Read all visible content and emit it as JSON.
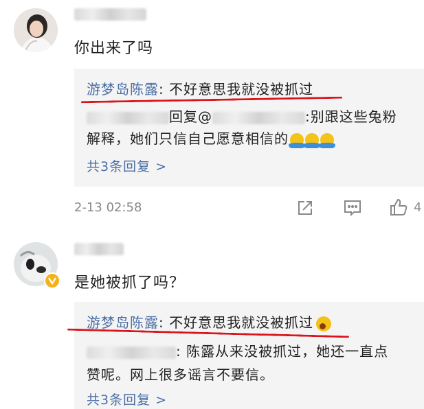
{
  "comments": [
    {
      "text": "你出来了吗",
      "reply_preview": {
        "author": "游梦岛陈露",
        "author_sep": ":",
        "author_text": " 不好意思我就没被抓过",
        "second_reply_mid": "回复@",
        "second_reply_tail": ":别跟这些兔粉",
        "second_reply_line2": "解释，她们只信自己愿意相信的",
        "more": "共3条回复 >"
      },
      "timestamp": "2-13 02:58",
      "like_count": "4"
    },
    {
      "text": "是她被抓了吗？",
      "reply_preview": {
        "author": "游梦岛陈露",
        "author_sep": ":",
        "author_text": " 不好意思我就没被抓过",
        "second_reply_tail": ": 陈露从来没被抓过，她还一直点",
        "second_reply_line2": "赞呢。网上很多谣言不要信。",
        "more": "共3条回复 >"
      }
    }
  ],
  "icons": [
    "share-icon",
    "comment-icon",
    "like-icon",
    "verified-badge-icon"
  ],
  "colors": {
    "link": "#4a6ea5",
    "underline": "#d9141a",
    "reply_bg": "#f4f4f4",
    "meta": "#888888"
  }
}
